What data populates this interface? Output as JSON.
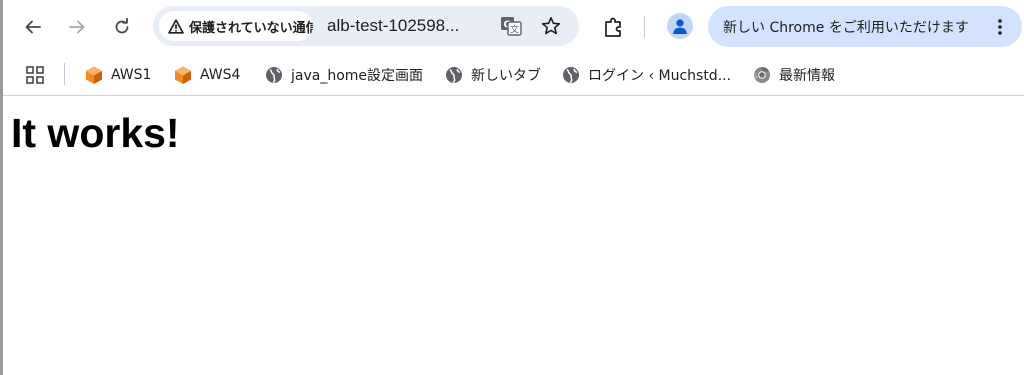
{
  "toolbar": {
    "back_icon": "arrow-left-icon",
    "forward_icon": "arrow-right-icon",
    "reload_icon": "reload-icon",
    "omnibox": {
      "security_label": "保護されていない通信",
      "security_icon": "warning-triangle-icon",
      "url": "alb-test-102598...",
      "translate_icon": "translate-icon",
      "bookmark_icon": "star-icon"
    },
    "extensions_icon": "puzzle-icon",
    "profile_icon": "person-icon",
    "chrome_banner": {
      "label": "新しい Chrome をご利用いただけます",
      "menu_icon": "kebab-menu-icon"
    }
  },
  "bookmarks_bar": {
    "apps_icon": "apps-grid-icon",
    "items": [
      {
        "label": "AWS1",
        "icon": "aws-cube-icon"
      },
      {
        "label": "AWS4",
        "icon": "aws-cube-icon"
      },
      {
        "label": "java_home設定画面",
        "icon": "globe-icon"
      },
      {
        "label": "新しいタブ",
        "icon": "globe-icon"
      },
      {
        "label": "ログイン ‹ Muchstd...",
        "icon": "globe-icon"
      },
      {
        "label": "最新情報",
        "icon": "chrome-icon"
      }
    ]
  },
  "page": {
    "heading": "It works!"
  },
  "colors": {
    "banner_bg": "#d3e3fd",
    "omnibox_bg": "#e9eef6",
    "aws_orange": "#f08a24",
    "profile_blue": "#0b57d0"
  }
}
